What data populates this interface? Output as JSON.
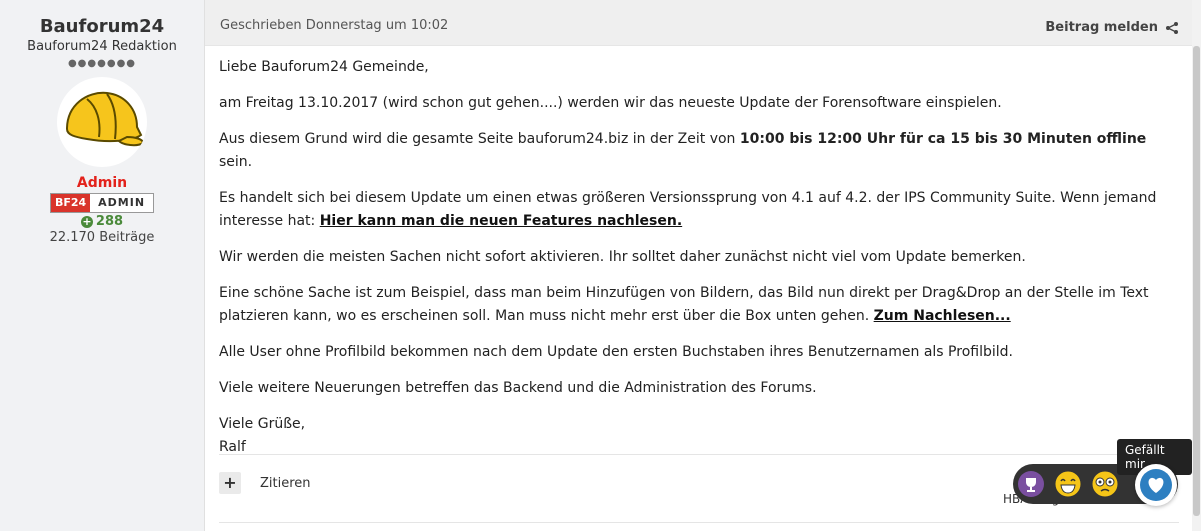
{
  "author": {
    "name": "Bauforum24",
    "title": "Bauforum24 Redaktion",
    "rank_dots": "●●●●●●●",
    "group": "Admin",
    "badge_left": "BF24",
    "badge_right": "ADMIN",
    "reputation": "288",
    "post_count": "22.170 Beiträge"
  },
  "post": {
    "date": "Geschrieben Donnerstag um 10:02",
    "report_label": "Beitrag melden",
    "paragraphs": {
      "p1": "Liebe Bauforum24 Gemeinde,",
      "p2": "am Freitag 13.10.2017 (wird schon gut gehen....) werden wir das neueste Update der Forensoftware einspielen.",
      "p3_a": "Aus diesem Grund wird die gesamte Seite bauforum24.biz in der Zeit von ",
      "p3_b": "10:00 bis 12:00 Uhr für ca 15 bis 30 Minuten offline",
      "p3_c": " sein.",
      "p4_a": "Es handelt sich bei diesem Update um einen etwas größeren Versionssprung von 4.1 auf 4.2. der IPS Community Suite. Wenn jemand interesse hat: ",
      "p4_link": "Hier kann man die neuen Features nachlesen.",
      "p5": "Wir werden die meisten Sachen nicht sofort aktivieren. Ihr solltet daher zunächst nicht viel vom Update bemerken.",
      "p6_a": "Eine schöne Sache ist zum Beispiel, dass man beim Hinzufügen von Bildern, das Bild nun direkt per Drag&Drop an der Stelle im Text platzieren kann, wo es erscheinen soll. Man muss nicht mehr erst über die Box unten gehen. ",
      "p6_link": "Zum Nachlesen...",
      "p7": "Alle User ohne Profilbild bekommen nach dem Update den ersten Buchstaben ihres Benutzernamen als Profilbild.",
      "p8": "Viele weitere Neuerungen betreffen das Backend und die Administration des Forums.",
      "p9_a": "Viele Grüße,",
      "p9_b": "Ralf"
    },
    "quote_label": "Zitieren",
    "reactions_text": "HBA reagierte darauf",
    "tooltip": "Gefällt mir"
  },
  "colors": {
    "admin_red": "#e3221b",
    "reputation_green": "#4a8a3a",
    "like_blue": "#2d7fc1"
  },
  "icons": [
    "plus-icon",
    "share-icon",
    "trophy-icon",
    "laugh-icon",
    "confused-icon",
    "heart-icon",
    "helmet-avatar"
  ]
}
